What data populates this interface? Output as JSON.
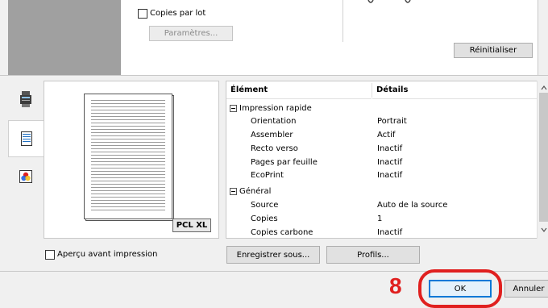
{
  "top": {
    "collate_label": "Copies par lot",
    "settings_button": "Paramètres...",
    "reset_button": "Réinitialiser"
  },
  "preview": {
    "badge": "PCL XL"
  },
  "table": {
    "headers": [
      "Élément",
      "Détails"
    ],
    "groups": [
      {
        "title": "Impression rapide",
        "rows": [
          [
            "Orientation",
            "Portrait"
          ],
          [
            "Assembler",
            "Actif"
          ],
          [
            "Recto verso",
            "Inactif"
          ],
          [
            "Pages par feuille",
            "Inactif"
          ],
          [
            "EcoPrint",
            "Inactif"
          ]
        ]
      },
      {
        "title": "Général",
        "rows": [
          [
            "Source",
            "Auto de la source"
          ],
          [
            "Copies",
            "1"
          ],
          [
            "Copies carbone",
            "Inactif"
          ]
        ]
      }
    ]
  },
  "bottom": {
    "preview_checkbox_label": "Aperçu avant impression",
    "save_as_button": "Enregistrer sous...",
    "profiles_button": "Profils...",
    "step_number": "8",
    "ok_button": "OK",
    "cancel_button": "Annuler"
  },
  "colors": {
    "highlight": "#e0201f",
    "focus": "#0078d7"
  }
}
